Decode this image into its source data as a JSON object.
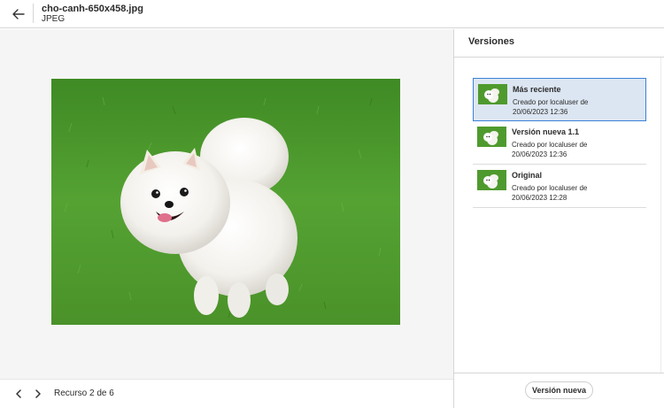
{
  "header": {
    "file_name": "cho-canh-650x458.jpg",
    "file_type": "JPEG",
    "back_icon": "arrow-left-icon"
  },
  "viewer": {
    "image_description_icon": "dog-photo"
  },
  "footer": {
    "prev_icon": "chevron-left-icon",
    "next_icon": "chevron-right-icon",
    "counter": "Recurso 2 de 6"
  },
  "panel": {
    "title": "Versiones",
    "versions": [
      {
        "title": "Más reciente",
        "meta_line1": "Creado por localuser de",
        "meta_line2": "20/06/2023 12:36"
      },
      {
        "title": "Versión nueva 1.1",
        "meta_line1": "Creado por localuser de",
        "meta_line2": "20/06/2023 12:36"
      },
      {
        "title": "Original",
        "meta_line1": "Creado por localuser de",
        "meta_line2": "20/06/2023 12:28"
      }
    ],
    "new_version_label": "Versión nueva"
  },
  "colors": {
    "selected_bg": "#dce6f2",
    "selected_border": "#3b82d6",
    "grass": "#4f9a2e"
  }
}
